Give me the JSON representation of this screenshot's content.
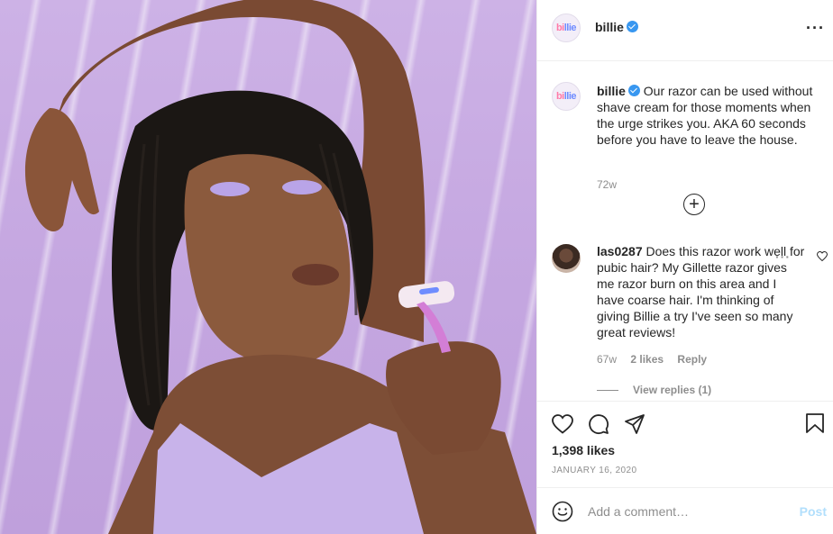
{
  "post": {
    "image_alt_icon": "post-photo",
    "account": {
      "username": "billie",
      "avatar_text_1": "bi",
      "avatar_text_2": "llie"
    },
    "header_more_icon": "more-options-icon"
  },
  "caption": {
    "username": "billie",
    "text": "Our razor can be used without shave cream for those moments when the urge strikes you. AKA 60 seconds before you have to leave the house.",
    "time": "72w"
  },
  "load_more_icon": "plus-circle-icon",
  "comments": [
    {
      "username": "las0287",
      "text": "Does this razor work well for pubic hair? My Gillette razor gives me razor burn on this area and I have coarse hair. I'm thinking of giving Billie a try I've seen so many great reviews!",
      "time": "67w",
      "likes": "2 likes",
      "reply": "Reply",
      "view_replies": "View replies (1)"
    }
  ],
  "actions": {
    "like_icon": "heart-icon",
    "comment_icon": "comment-icon",
    "share_icon": "share-icon",
    "save_icon": "bookmark-icon",
    "likes_count": "1,398 likes",
    "date": "JANUARY 16, 2020"
  },
  "add_comment": {
    "placeholder": "Add a comment…",
    "post_label": "Post",
    "emoji_icon": "emoji-icon"
  },
  "colors": {
    "background_photo": "#c9ace2",
    "verified_badge": "#3897f0",
    "post_button_disabled": "#b2dffc",
    "text_secondary": "#8e8e8e"
  }
}
